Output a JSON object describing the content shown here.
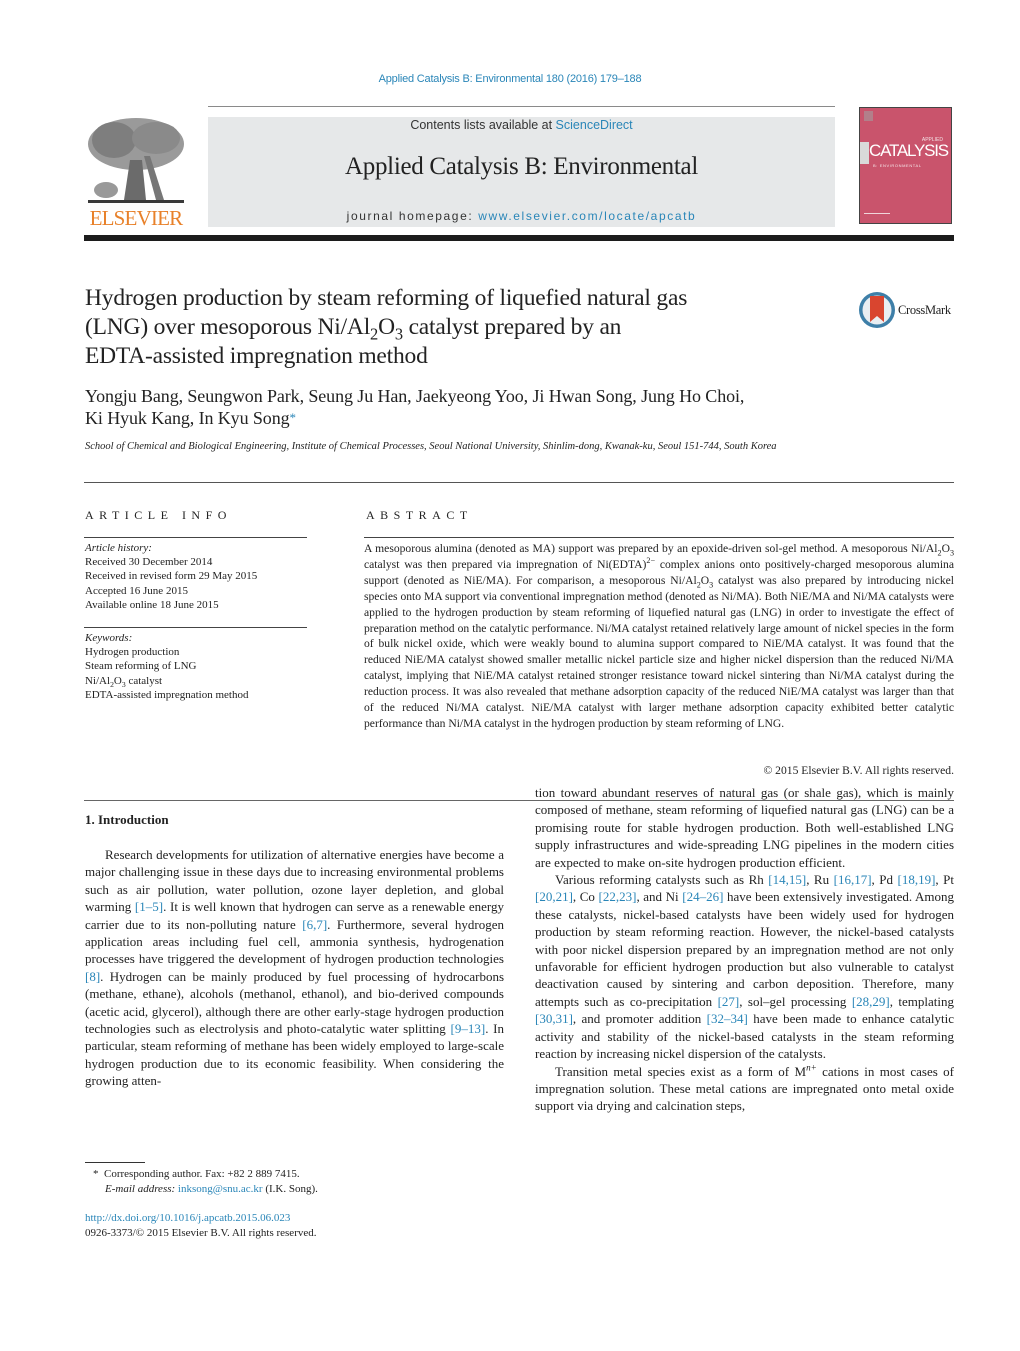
{
  "header": {
    "running_head": "Applied Catalysis B: Environmental 180 (2016) 179–188",
    "publisher_logo_text": "ELSEVIER",
    "contents_prefix": "Contents lists available at ",
    "contents_link": "ScienceDirect",
    "journal_title": "Applied Catalysis B: Environmental",
    "homepage_prefix": "journal homepage: ",
    "homepage_link": "www.elsevier.com/locate/apcatb",
    "cover": {
      "title": "CATALYSIS",
      "kicker": "APPLIED",
      "subtitle": "B: ENVIRONMENTAL",
      "color": "#c9546c"
    },
    "brand_colors": {
      "link": "#2a86b8",
      "elsevier_orange": "#e8812a"
    }
  },
  "article": {
    "title_line1": "Hydrogen production by steam reforming of liquefied natural gas",
    "title_line2_pre": "(LNG) over mesoporous Ni/Al",
    "title_sub1": "2",
    "title_mid": "O",
    "title_sub2": "3",
    "title_line2_post": " catalyst prepared by an",
    "title_line3": "EDTA-assisted impregnation method",
    "crossmark_label": "CrossMark",
    "authors_line1": "Yongju Bang, Seungwon Park, Seung Ju Han, Jaekyeong Yoo, Ji Hwan Song, Jung Ho Choi,",
    "authors_line2": "Ki Hyuk Kang, In Kyu Song",
    "corresponding_marker": "*",
    "affiliation": "School of Chemical and Biological Engineering, Institute of Chemical Processes, Seoul National University, Shinlim-dong, Kwanak-ku, Seoul 151-744, South Korea"
  },
  "article_info": {
    "heading": "ARTICLE INFO",
    "history_label": "Article history:",
    "history": [
      "Received 30 December 2014",
      "Received in revised form 29 May 2015",
      "Accepted 16 June 2015",
      "Available online 18 June 2015"
    ],
    "keywords_label": "Keywords:",
    "keywords": [
      "Hydrogen production",
      "Steam reforming of LNG",
      "Ni/Al2O3 catalyst",
      "EDTA-assisted impregnation method"
    ]
  },
  "abstract": {
    "heading": "ABSTRACT",
    "p1": "A mesoporous alumina (denoted as MA) support was prepared by an epoxide-driven sol-gel method. A mesoporous Ni/Al",
    "p2": " catalyst was then prepared via impregnation of Ni(EDTA)",
    "p2_sup": "2−",
    "p3": " complex anions onto positively-charged mesoporous alumina support (denoted as NiE/MA). For comparison, a mesoporous Ni/Al",
    "p4": " catalyst was also prepared by introducing nickel species onto MA support via conventional impregnation method (denoted as Ni/MA). Both NiE/MA and Ni/MA catalysts were applied to the hydrogen production by steam reforming of liquefied natural gas (LNG) in order to investigate the effect of preparation method on the catalytic performance. Ni/MA catalyst retained relatively large amount of nickel species in the form of bulk nickel oxide, which were weakly bound to alumina support compared to NiE/MA catalyst. It was found that the reduced NiE/MA catalyst showed smaller metallic nickel particle size and higher nickel dispersion than the reduced Ni/MA catalyst, implying that NiE/MA catalyst retained stronger resistance toward nickel sintering than Ni/MA catalyst during the reduction process. It was also revealed that methane adsorption capacity of the reduced NiE/MA catalyst was larger than that of the reduced Ni/MA catalyst. NiE/MA catalyst with larger methane adsorption capacity exhibited better catalytic performance than Ni/MA catalyst in the hydrogen production by steam reforming of LNG.",
    "copyright": "© 2015 Elsevier B.V. All rights reserved."
  },
  "body": {
    "section_heading": "1.  Introduction",
    "left": [
      {
        "t": "Research developments for utilization of alternative energies have become a major challenging issue in these days due to increasing environmental problems such as air pollution, water pollution, ozone layer depletion, and global warming "
      },
      {
        "ref": "[1–5]"
      },
      {
        "t": ". It is well known that hydrogen can serve as a renewable energy carrier due to its non-polluting nature "
      },
      {
        "ref": "[6,7]"
      },
      {
        "t": ". Furthermore, several hydrogen application areas including fuel cell, ammonia synthesis, hydrogenation processes have triggered the development of hydrogen production technologies "
      },
      {
        "ref": "[8]"
      },
      {
        "t": ". Hydrogen can be mainly produced by fuel processing of hydrocarbons (methane, ethane), alcohols (methanol, ethanol), and bio-derived compounds (acetic acid, glycerol), although there are other early-stage hydrogen production technologies such as electrolysis and photo-catalytic water splitting "
      },
      {
        "ref": "[9–13]"
      },
      {
        "t": ". In particular, steam reforming of methane has been widely employed to large-scale hydrogen production due to its economic feasibility. When considering the growing atten-"
      }
    ],
    "right_p1": "tion toward abundant reserves of natural gas (or shale gas), which is mainly composed of methane, steam reforming of liquefied natural gas (LNG) can be a promising route for stable hydrogen production. Both well-established LNG supply infrastructures and wide-spreading LNG pipelines in the modern cities are expected to make on-site hydrogen production efficient.",
    "right_p2": [
      {
        "t": "Various reforming catalysts such as Rh "
      },
      {
        "ref": "[14,15]"
      },
      {
        "t": ", Ru "
      },
      {
        "ref": "[16,17]"
      },
      {
        "t": ", Pd "
      },
      {
        "ref": "[18,19]"
      },
      {
        "t": ", Pt "
      },
      {
        "ref": "[20,21]"
      },
      {
        "t": ", Co "
      },
      {
        "ref": "[22,23]"
      },
      {
        "t": ", and Ni "
      },
      {
        "ref": "[24–26]"
      },
      {
        "t": " have been extensively investigated. Among these catalysts, nickel-based catalysts have been widely used for hydrogen production by steam reforming reaction. However, the nickel-based catalysts with poor nickel dispersion prepared by an impregnation method are not only unfavorable for efficient hydrogen production but also vulnerable to catalyst deactivation caused by sintering and carbon deposition. Therefore, many attempts such as co-precipitation "
      },
      {
        "ref": "[27]"
      },
      {
        "t": ", sol–gel processing "
      },
      {
        "ref": "[28,29]"
      },
      {
        "t": ", templating "
      },
      {
        "ref": "[30,31]"
      },
      {
        "t": ", and promoter addition "
      },
      {
        "ref": "[32–34]"
      },
      {
        "t": " have been made to enhance catalytic activity and stability of the nickel-based catalysts in the steam reforming reaction by increasing nickel dispersion of the catalysts."
      }
    ],
    "right_p3_pre": "Transition metal species exist as a form of M",
    "right_p3_sup": "n+",
    "right_p3_post": " cations in most cases of impregnation solution. These metal cations are impregnated onto metal oxide support via drying and calcination steps,"
  },
  "footnotes": {
    "corresponding": "Corresponding author. Fax: +82 2 889 7415.",
    "email_label": "E-mail address: ",
    "email": "inksong@snu.ac.kr",
    "email_suffix": " (I.K. Song).",
    "doi": "http://dx.doi.org/10.1016/j.apcatb.2015.06.023",
    "issn": "0926-3373/© 2015 Elsevier B.V. All rights reserved."
  }
}
